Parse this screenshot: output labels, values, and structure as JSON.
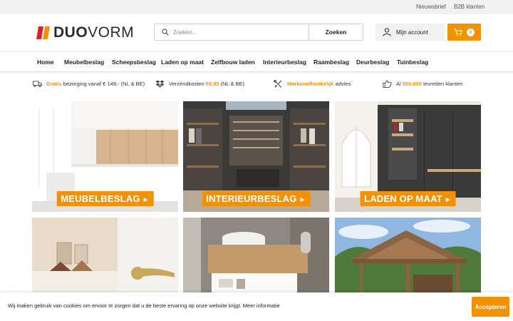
{
  "topbar": {
    "newsletter": "Nieuwsbrief",
    "b2b": "B2B klanten"
  },
  "logo": {
    "part1": "DUO",
    "part2": "VORM",
    "icon": "duovorm-logo-icon"
  },
  "search": {
    "placeholder": "Zoeken...",
    "value": "",
    "button": "Zoeken",
    "icon": "search-icon"
  },
  "account": {
    "label": "Mijn account",
    "icon": "user-icon"
  },
  "cart": {
    "count": "0",
    "icon": "cart-icon"
  },
  "nav": [
    "Home",
    "Meubelbeslag",
    "Scheepsbeslag",
    "Laden op maat",
    "Zelfbouw laden",
    "Interieurbeslag",
    "Raambeslag",
    "Deurbeslag",
    "Tuinbeslag"
  ],
  "usps": [
    {
      "icon": "truck-icon",
      "highlight": "Gratis",
      "text": " bezorging vanaf € 149,- (NL & BE)"
    },
    {
      "icon": "dropbox-icon",
      "pre": "Verzendkosten ",
      "highlight": "€6,95",
      "text": " (NL & BE)"
    },
    {
      "icon": "tools-icon",
      "highlight": "Merkonafhankelijk",
      "text": " advies"
    },
    {
      "icon": "thumbs-up-icon",
      "pre": "Al ",
      "highlight": "500.000",
      "text": " tevreden klanten"
    }
  ],
  "tiles": [
    {
      "label": "MEUBELBESLAG",
      "arrow": "►"
    },
    {
      "label": "INTERIEURBESLAG",
      "arrow": "►"
    },
    {
      "label": "LADEN OP MAAT",
      "arrow": "►"
    },
    {
      "label": ""
    },
    {
      "label": ""
    },
    {
      "label": ""
    }
  ],
  "cookie": {
    "text": "Wij maken gebruik van cookies om ervoor te zorgen dat u de beste ervaring op onze website krijgt. Meer informatie",
    "accept": "Accepteren"
  },
  "colors": {
    "accent": "#f39200",
    "logo_red": "#d8232a",
    "text": "#222222"
  }
}
